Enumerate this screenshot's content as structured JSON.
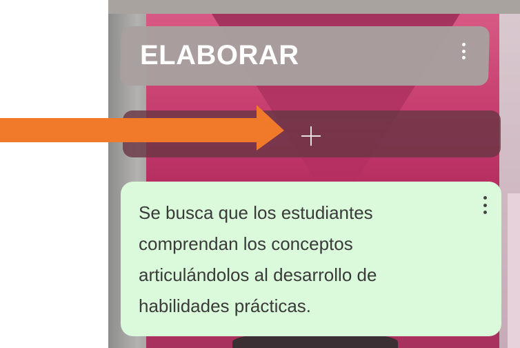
{
  "column": {
    "title": "ELABORAR",
    "menu_icon": "more-vertical-icon"
  },
  "add_post": {
    "icon": "plus-icon"
  },
  "annotation": {
    "arrow_color": "#f07a2a",
    "arrow_icon": "arrow-right-icon"
  },
  "post": {
    "text": "Se busca que los estudiantes comprendan los conceptos articulándolos al desarrollo de habilidades prácticas.",
    "background": "#dbfadb",
    "menu_icon": "more-vertical-icon"
  },
  "colors": {
    "header_card": "#a8a09e",
    "add_bar": "#693746",
    "board_pink": "#c3386a"
  }
}
